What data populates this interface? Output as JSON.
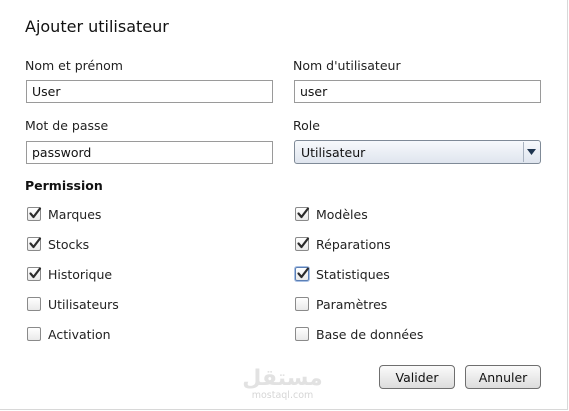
{
  "dialog": {
    "title": "Ajouter utilisateur"
  },
  "form": {
    "fullname": {
      "label": "Nom et prénom",
      "value": "User"
    },
    "username": {
      "label": "Nom d'utilisateur",
      "value": "user"
    },
    "password": {
      "label": "Mot de passe",
      "value": "password"
    },
    "role": {
      "label": "Role",
      "value": "Utilisateur"
    }
  },
  "permissions": {
    "title": "Permission",
    "left": [
      {
        "label": "Marques",
        "checked": true
      },
      {
        "label": "Stocks",
        "checked": true
      },
      {
        "label": "Historique",
        "checked": true
      },
      {
        "label": "Utilisateurs",
        "checked": false
      },
      {
        "label": "Activation",
        "checked": false
      }
    ],
    "right": [
      {
        "label": "Modèles",
        "checked": true
      },
      {
        "label": "Réparations",
        "checked": true
      },
      {
        "label": "Statistiques",
        "checked": true,
        "focused": true
      },
      {
        "label": "Paramètres",
        "checked": false
      },
      {
        "label": "Base de données",
        "checked": false
      }
    ]
  },
  "buttons": {
    "ok": "Valider",
    "cancel": "Annuler"
  },
  "watermark": {
    "arabic": "مستقل",
    "latin": "mostaql.com"
  },
  "colors": {
    "check": "#2b2b2b",
    "focus": "#5b7fb5"
  },
  "icons": {
    "check": "check-icon",
    "dropdown": "chevron-down-icon"
  }
}
